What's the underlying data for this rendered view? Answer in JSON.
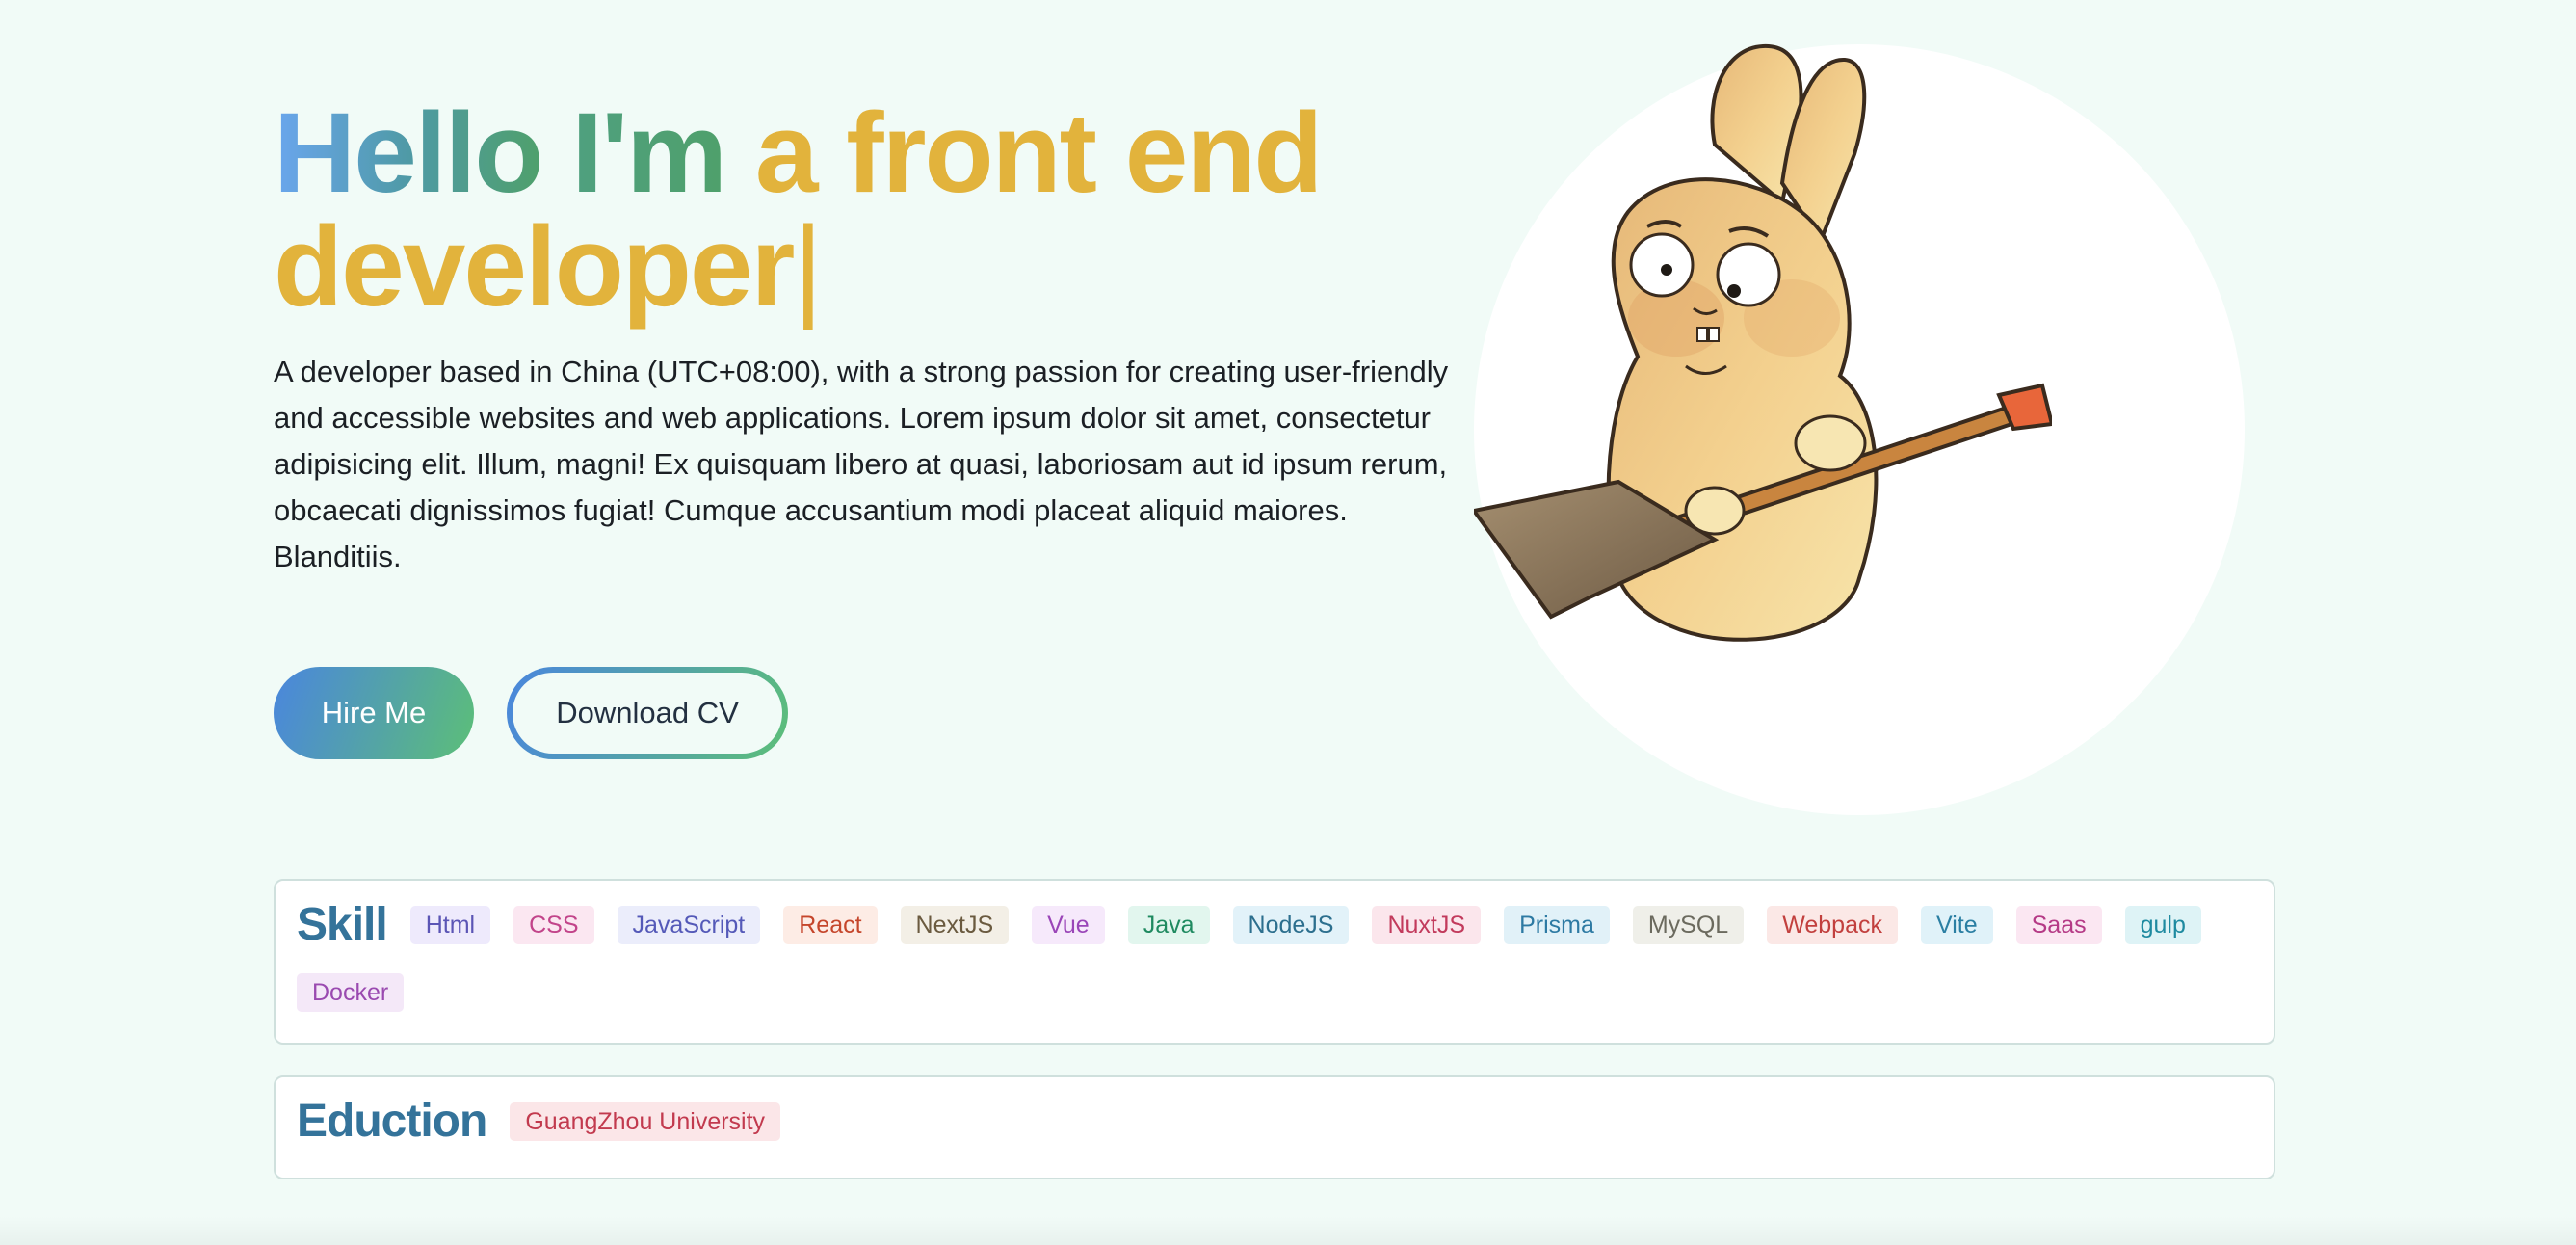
{
  "hero": {
    "headline_part1": "Hello",
    "headline_part2": "I'm",
    "headline_part3": "a front end",
    "headline_part4": "developer",
    "cursor": "|",
    "intro": "A developer based in China (UTC+08:00), with a strong passion for creating user-friendly and accessible websites and web applications. Lorem ipsum dolor sit amet, consectetur adipisicing elit. Illum, magni! Ex quisquam libero at quasi, laboriosam aut id ipsum rerum, obcaecati dignissimos fugiat! Cumque accusantium modi placeat aliquid maiores. Blanditiis."
  },
  "actions": {
    "hire_label": "Hire Me",
    "cv_label": "Download CV"
  },
  "skills": {
    "title": "Skill",
    "items": [
      {
        "label": "Html",
        "color": "#5b55b5",
        "bg": "#eeeafc"
      },
      {
        "label": "CSS",
        "color": "#c2448a",
        "bg": "#fbe7f1"
      },
      {
        "label": "JavaScript",
        "color": "#5459b8",
        "bg": "#ebedfb"
      },
      {
        "label": "React",
        "color": "#c5462b",
        "bg": "#fdece5"
      },
      {
        "label": "NextJS",
        "color": "#6a5a3f",
        "bg": "#f3efe6"
      },
      {
        "label": "Vue",
        "color": "#9a45b8",
        "bg": "#f6e9fb"
      },
      {
        "label": "Java",
        "color": "#1f8a60",
        "bg": "#e2f6ee"
      },
      {
        "label": "NodeJS",
        "color": "#2c6f8e",
        "bg": "#e2f2f9"
      },
      {
        "label": "NuxtJS",
        "color": "#c23a5c",
        "bg": "#fbe6ec"
      },
      {
        "label": "Prisma",
        "color": "#2d7aa3",
        "bg": "#e1f1f8"
      },
      {
        "label": "MySQL",
        "color": "#6b6a5e",
        "bg": "#efefe9"
      },
      {
        "label": "Webpack",
        "color": "#c2403e",
        "bg": "#fbe8e6"
      },
      {
        "label": "Vite",
        "color": "#2b7fa3",
        "bg": "#e0f2f9"
      },
      {
        "label": "Saas",
        "color": "#b53a86",
        "bg": "#fbe7f2"
      },
      {
        "label": "gulp",
        "color": "#1e8aa0",
        "bg": "#def3f6"
      },
      {
        "label": "Docker",
        "color": "#9a4ab0",
        "bg": "#f4e8f8"
      }
    ]
  },
  "education": {
    "title": "Eduction",
    "items": [
      {
        "label": "GuangZhou University",
        "color": "#c23a4e",
        "bg": "#fbe6e8"
      }
    ]
  },
  "avatar": {
    "icon": "rabbit-with-shovel-illustration"
  }
}
